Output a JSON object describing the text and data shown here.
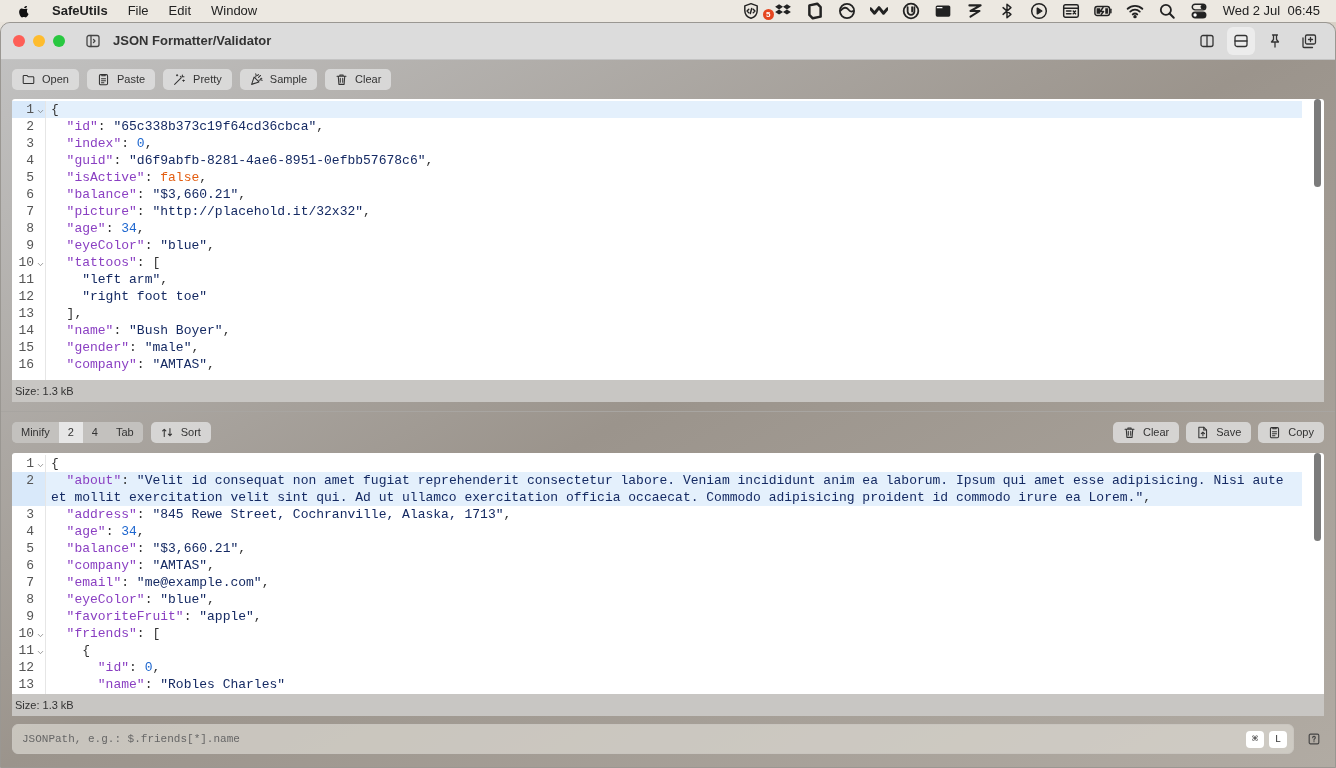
{
  "menu_bar": {
    "app_name": "SafeUtils",
    "menus": [
      "File",
      "Edit",
      "Window"
    ],
    "status_icons": [
      {
        "kind": "code-shield"
      },
      {
        "kind": "dropbox",
        "badge": "5"
      },
      {
        "kind": "square-spin"
      },
      {
        "kind": "circle-arc"
      },
      {
        "kind": "wave"
      },
      {
        "kind": "torrent"
      },
      {
        "kind": "window"
      },
      {
        "kind": "zigzag"
      },
      {
        "kind": "bluetooth"
      },
      {
        "kind": "play"
      },
      {
        "kind": "panel"
      },
      {
        "kind": "battery"
      },
      {
        "kind": "wifi"
      },
      {
        "kind": "search"
      },
      {
        "kind": "switches"
      }
    ],
    "clock": "Wed 2 Jul  06:45"
  },
  "window": {
    "title": "JSON Formatter/Validator",
    "layout_buttons": [
      {
        "kind": "columns",
        "selected": false
      },
      {
        "kind": "rows",
        "selected": true
      },
      {
        "kind": "pin",
        "selected": false
      },
      {
        "kind": "new-window",
        "selected": false
      }
    ]
  },
  "input_toolbar": [
    {
      "kind": "folder",
      "label": "Open"
    },
    {
      "kind": "clipboard",
      "label": "Paste"
    },
    {
      "kind": "wand",
      "label": "Pretty"
    },
    {
      "kind": "confetti",
      "label": "Sample"
    },
    {
      "kind": "trash",
      "label": "Clear"
    }
  ],
  "input_editor": {
    "lines": [
      {
        "number": "1",
        "fold": true,
        "current": true,
        "tokens": [
          {
            "kind": "punct",
            "text": "{"
          }
        ]
      },
      {
        "number": "2",
        "fold": false,
        "current": false,
        "tokens": [
          {
            "kind": "key",
            "text": "  \"id\""
          },
          {
            "kind": "punct",
            "text": ": "
          },
          {
            "kind": "string",
            "text": "\"65c338b373c19f64cd36cbca\""
          },
          {
            "kind": "punct",
            "text": ","
          }
        ]
      },
      {
        "number": "3",
        "fold": false,
        "current": false,
        "tokens": [
          {
            "kind": "key",
            "text": "  \"index\""
          },
          {
            "kind": "punct",
            "text": ": "
          },
          {
            "kind": "number",
            "text": "0"
          },
          {
            "kind": "punct",
            "text": ","
          }
        ]
      },
      {
        "number": "4",
        "fold": false,
        "current": false,
        "tokens": [
          {
            "kind": "key",
            "text": "  \"guid\""
          },
          {
            "kind": "punct",
            "text": ": "
          },
          {
            "kind": "string",
            "text": "\"d6f9abfb-8281-4ae6-8951-0efbb57678c6\""
          },
          {
            "kind": "punct",
            "text": ","
          }
        ]
      },
      {
        "number": "5",
        "fold": false,
        "current": false,
        "tokens": [
          {
            "kind": "key",
            "text": "  \"isActive\""
          },
          {
            "kind": "punct",
            "text": ": "
          },
          {
            "kind": "bool",
            "text": "false"
          },
          {
            "kind": "punct",
            "text": ","
          }
        ]
      },
      {
        "number": "6",
        "fold": false,
        "current": false,
        "tokens": [
          {
            "kind": "key",
            "text": "  \"balance\""
          },
          {
            "kind": "punct",
            "text": ": "
          },
          {
            "kind": "string",
            "text": "\"$3,660.21\""
          },
          {
            "kind": "punct",
            "text": ","
          }
        ]
      },
      {
        "number": "7",
        "fold": false,
        "current": false,
        "tokens": [
          {
            "kind": "key",
            "text": "  \"picture\""
          },
          {
            "kind": "punct",
            "text": ": "
          },
          {
            "kind": "string",
            "text": "\"http://placehold.it/32x32\""
          },
          {
            "kind": "punct",
            "text": ","
          }
        ]
      },
      {
        "number": "8",
        "fold": false,
        "current": false,
        "tokens": [
          {
            "kind": "key",
            "text": "  \"age\""
          },
          {
            "kind": "punct",
            "text": ": "
          },
          {
            "kind": "number",
            "text": "34"
          },
          {
            "kind": "punct",
            "text": ","
          }
        ]
      },
      {
        "number": "9",
        "fold": false,
        "current": false,
        "tokens": [
          {
            "kind": "key",
            "text": "  \"eyeColor\""
          },
          {
            "kind": "punct",
            "text": ": "
          },
          {
            "kind": "string",
            "text": "\"blue\""
          },
          {
            "kind": "punct",
            "text": ","
          }
        ]
      },
      {
        "number": "10",
        "fold": true,
        "current": false,
        "tokens": [
          {
            "kind": "key",
            "text": "  \"tattoos\""
          },
          {
            "kind": "punct",
            "text": ": ["
          }
        ]
      },
      {
        "number": "11",
        "fold": false,
        "current": false,
        "tokens": [
          {
            "kind": "string",
            "text": "    \"left arm\""
          },
          {
            "kind": "punct",
            "text": ","
          }
        ]
      },
      {
        "number": "12",
        "fold": false,
        "current": false,
        "tokens": [
          {
            "kind": "string",
            "text": "    \"right foot toe\""
          }
        ]
      },
      {
        "number": "13",
        "fold": false,
        "current": false,
        "tokens": [
          {
            "kind": "punct",
            "text": "  ],"
          }
        ]
      },
      {
        "number": "14",
        "fold": false,
        "current": false,
        "tokens": [
          {
            "kind": "key",
            "text": "  \"name\""
          },
          {
            "kind": "punct",
            "text": ": "
          },
          {
            "kind": "string",
            "text": "\"Bush Boyer\""
          },
          {
            "kind": "punct",
            "text": ","
          }
        ]
      },
      {
        "number": "15",
        "fold": false,
        "current": false,
        "tokens": [
          {
            "kind": "key",
            "text": "  \"gender\""
          },
          {
            "kind": "punct",
            "text": ": "
          },
          {
            "kind": "string",
            "text": "\"male\""
          },
          {
            "kind": "punct",
            "text": ","
          }
        ]
      },
      {
        "number": "16",
        "fold": false,
        "current": false,
        "tokens": [
          {
            "kind": "key",
            "text": "  \"company\""
          },
          {
            "kind": "punct",
            "text": ": "
          },
          {
            "kind": "string",
            "text": "\"AMTAS\""
          },
          {
            "kind": "punct",
            "text": ","
          }
        ]
      }
    ],
    "status": "Size: 1.3 kB"
  },
  "indent_options": [
    {
      "label": "Minify",
      "selected": false
    },
    {
      "label": "2",
      "selected": true
    },
    {
      "label": "4",
      "selected": false
    },
    {
      "label": "Tab",
      "selected": false
    }
  ],
  "sort_button": "Sort",
  "output_toolbar": [
    {
      "kind": "trash",
      "label": "Clear"
    },
    {
      "kind": "save",
      "label": "Save"
    },
    {
      "kind": "clipboard",
      "label": "Copy"
    }
  ],
  "output_editor": {
    "lines": [
      {
        "number": "1",
        "fold": true,
        "current": false,
        "tokens": [
          {
            "kind": "punct",
            "text": "{"
          }
        ]
      },
      {
        "number": "2",
        "fold": false,
        "current": true,
        "tokens": [
          {
            "kind": "key",
            "text": "  \"about\""
          },
          {
            "kind": "punct",
            "text": ": "
          },
          {
            "kind": "string",
            "text": "\"Velit id consequat non amet fugiat reprehenderit consectetur labore. Veniam incididunt anim ea laborum. Ipsum qui amet esse adipisicing. Nisi aute et mollit exercitation velit sint qui. Ad ut ullamco exercitation officia occaecat. Commodo adipisicing proident id commodo irure ea Lorem.\""
          },
          {
            "kind": "punct",
            "text": ","
          }
        ]
      },
      {
        "number": "3",
        "fold": false,
        "current": false,
        "tokens": [
          {
            "kind": "key",
            "text": "  \"address\""
          },
          {
            "kind": "punct",
            "text": ": "
          },
          {
            "kind": "string",
            "text": "\"845 Rewe Street, Cochranville, Alaska, 1713\""
          },
          {
            "kind": "punct",
            "text": ","
          }
        ]
      },
      {
        "number": "4",
        "fold": false,
        "current": false,
        "tokens": [
          {
            "kind": "key",
            "text": "  \"age\""
          },
          {
            "kind": "punct",
            "text": ": "
          },
          {
            "kind": "number",
            "text": "34"
          },
          {
            "kind": "punct",
            "text": ","
          }
        ]
      },
      {
        "number": "5",
        "fold": false,
        "current": false,
        "tokens": [
          {
            "kind": "key",
            "text": "  \"balance\""
          },
          {
            "kind": "punct",
            "text": ": "
          },
          {
            "kind": "string",
            "text": "\"$3,660.21\""
          },
          {
            "kind": "punct",
            "text": ","
          }
        ]
      },
      {
        "number": "6",
        "fold": false,
        "current": false,
        "tokens": [
          {
            "kind": "key",
            "text": "  \"company\""
          },
          {
            "kind": "punct",
            "text": ": "
          },
          {
            "kind": "string",
            "text": "\"AMTAS\""
          },
          {
            "kind": "punct",
            "text": ","
          }
        ]
      },
      {
        "number": "7",
        "fold": false,
        "current": false,
        "tokens": [
          {
            "kind": "key",
            "text": "  \"email\""
          },
          {
            "kind": "punct",
            "text": ": "
          },
          {
            "kind": "string",
            "text": "\"me@example.com\""
          },
          {
            "kind": "punct",
            "text": ","
          }
        ]
      },
      {
        "number": "8",
        "fold": false,
        "current": false,
        "tokens": [
          {
            "kind": "key",
            "text": "  \"eyeColor\""
          },
          {
            "kind": "punct",
            "text": ": "
          },
          {
            "kind": "string",
            "text": "\"blue\""
          },
          {
            "kind": "punct",
            "text": ","
          }
        ]
      },
      {
        "number": "9",
        "fold": false,
        "current": false,
        "tokens": [
          {
            "kind": "key",
            "text": "  \"favoriteFruit\""
          },
          {
            "kind": "punct",
            "text": ": "
          },
          {
            "kind": "string",
            "text": "\"apple\""
          },
          {
            "kind": "punct",
            "text": ","
          }
        ]
      },
      {
        "number": "10",
        "fold": true,
        "current": false,
        "tokens": [
          {
            "kind": "key",
            "text": "  \"friends\""
          },
          {
            "kind": "punct",
            "text": ": ["
          }
        ]
      },
      {
        "number": "11",
        "fold": true,
        "current": false,
        "tokens": [
          {
            "kind": "punct",
            "text": "    {"
          }
        ]
      },
      {
        "number": "12",
        "fold": false,
        "current": false,
        "tokens": [
          {
            "kind": "key",
            "text": "      \"id\""
          },
          {
            "kind": "punct",
            "text": ": "
          },
          {
            "kind": "number",
            "text": "0"
          },
          {
            "kind": "punct",
            "text": ","
          }
        ]
      },
      {
        "number": "13",
        "fold": false,
        "current": false,
        "tokens": [
          {
            "kind": "key",
            "text": "      \"name\""
          },
          {
            "kind": "punct",
            "text": ": "
          },
          {
            "kind": "string",
            "text": "\"Robles Charles\""
          }
        ]
      }
    ],
    "status": "Size: 1.3 kB"
  },
  "query_field": {
    "placeholder": "JSONPath, e.g.: $.friends[*].name",
    "shortcut_keys": [
      "⌘",
      "L"
    ]
  }
}
